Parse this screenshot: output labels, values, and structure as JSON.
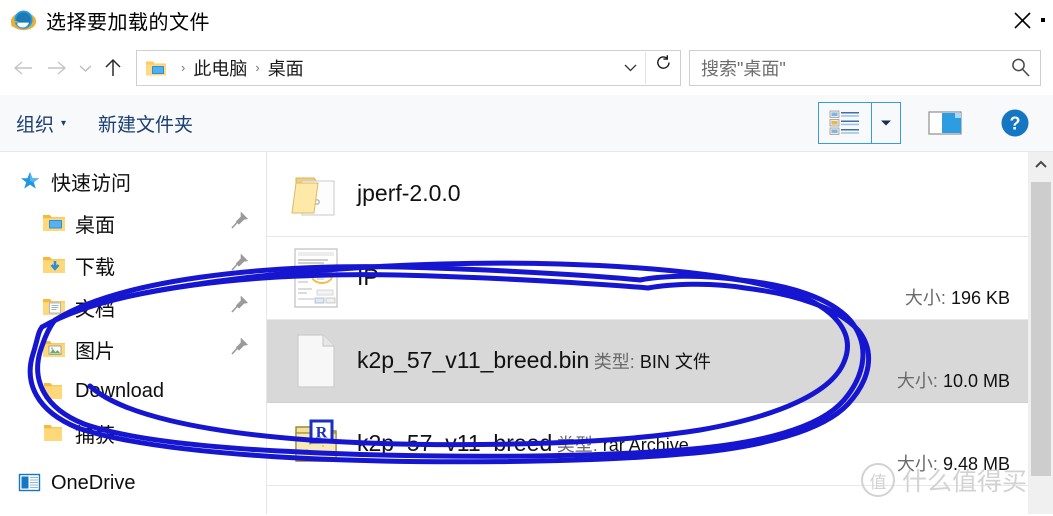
{
  "window": {
    "title": "选择要加载的文件",
    "app_icon": "internet-explorer-icon",
    "close_label": "✕"
  },
  "nav": {
    "back": "←",
    "forward": "→",
    "history": "⌄",
    "up": "↑",
    "address": {
      "icon": "desktop-folder-icon",
      "crumbs": [
        "此电脑",
        "桌面"
      ],
      "separator": "›",
      "dropdown": "⌄",
      "refresh": "↻"
    },
    "search": {
      "placeholder": "搜索\"桌面\"",
      "icon": "search-icon"
    }
  },
  "command_bar": {
    "organize": "组织",
    "organize_caret": "▾",
    "new_folder": "新建文件夹",
    "view_icon": "content-view-icon",
    "view_caret": "▼",
    "preview_pane_icon": "preview-pane-icon",
    "help_icon": "help-icon"
  },
  "sidebar": {
    "items": [
      {
        "label": "快速访问",
        "icon": "star-icon",
        "level": 0,
        "pinned": false
      },
      {
        "label": "桌面",
        "icon": "desktop-folder-icon",
        "level": 1,
        "pinned": true
      },
      {
        "label": "下载",
        "icon": "downloads-folder-icon",
        "level": 1,
        "pinned": true
      },
      {
        "label": "文档",
        "icon": "documents-folder-icon",
        "level": 1,
        "pinned": true
      },
      {
        "label": "图片",
        "icon": "pictures-folder-icon",
        "level": 1,
        "pinned": true
      },
      {
        "label": "Download",
        "icon": "folder-icon",
        "level": 1,
        "pinned": false
      },
      {
        "label": "捕获",
        "icon": "folder-icon",
        "level": 1,
        "pinned": false
      },
      {
        "label": "OneDrive",
        "icon": "onedrive-icon",
        "level": 0,
        "pinned": false
      }
    ]
  },
  "files": {
    "rows": [
      {
        "name": "jperf-2.0.0",
        "type": "",
        "type_label": "",
        "size": "",
        "size_label": "",
        "icon": "folder-icon",
        "selected": false
      },
      {
        "name": "IP",
        "type": "",
        "type_label": "",
        "size": "196 KB",
        "size_label": "大小:",
        "icon": "image-thumbnail-icon",
        "selected": false
      },
      {
        "name": "k2p_57_v11_breed.bin",
        "type": "BIN 文件",
        "type_label": "类型:",
        "size": "10.0 MB",
        "size_label": "大小:",
        "icon": "blank-document-icon",
        "selected": true
      },
      {
        "name": "k2p_57_v11_breed",
        "type": "rar Archive",
        "type_label": "类型:",
        "size": "9.48 MB",
        "size_label": "大小:",
        "icon": "winrar-archive-icon",
        "selected": false
      }
    ]
  },
  "scrollbar": {
    "up_arrow": "⌃"
  },
  "annotation": {
    "color": "#1616d0",
    "shape": "hand-drawn-ellipse-around-selected-file"
  },
  "watermark": {
    "logo_char": "值",
    "text": "什么值得买"
  },
  "colors": {
    "selection": "#d8d8d8",
    "accent_blue": "#3a9bdc",
    "command_text": "#1b3f73",
    "annotation": "#1616d0"
  }
}
